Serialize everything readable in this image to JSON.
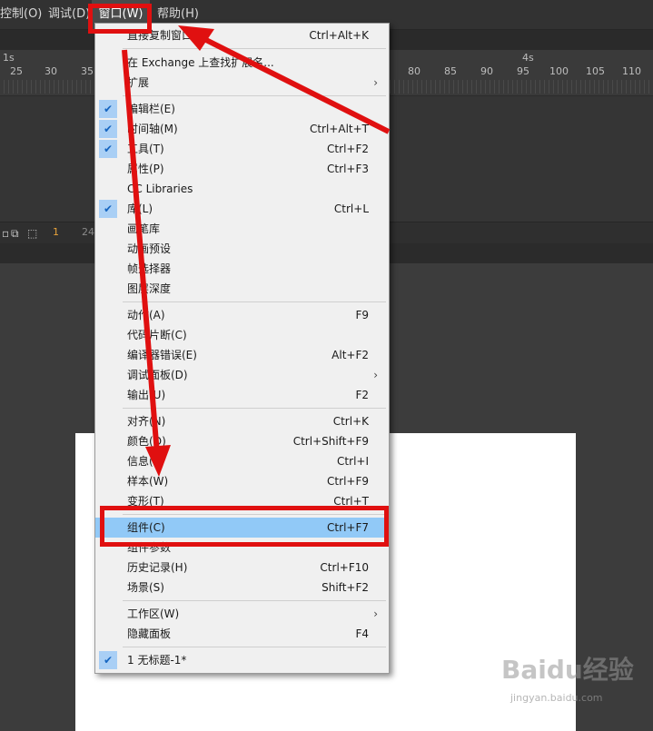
{
  "menubar": {
    "items": [
      {
        "label": "控制(O)"
      },
      {
        "label": "调试(D)"
      },
      {
        "label": "窗口(W)"
      },
      {
        "label": "帮助(H)"
      }
    ]
  },
  "ruler": {
    "seconds": [
      "1s",
      "4s"
    ],
    "frames": [
      "25",
      "30",
      "35",
      "80",
      "85",
      "90",
      "95",
      "100",
      "105",
      "110"
    ]
  },
  "timeline_toolbar": {
    "frame_a": "1",
    "frame_b": "24"
  },
  "menu": {
    "items": [
      {
        "label": "直接复制窗口(D)",
        "shortcut": "Ctrl+Alt+K"
      },
      {
        "label": "在 Exchange 上查找扩展名...",
        "shortcut": ""
      },
      {
        "label": "扩展",
        "shortcut": "",
        "submenu": true
      },
      {
        "label": "编辑栏(E)",
        "shortcut": "",
        "checked": true
      },
      {
        "label": "时间轴(M)",
        "shortcut": "Ctrl+Alt+T",
        "checked": true
      },
      {
        "label": "工具(T)",
        "shortcut": "Ctrl+F2",
        "checked": true
      },
      {
        "label": "属性(P)",
        "shortcut": "Ctrl+F3"
      },
      {
        "label": "CC Libraries",
        "shortcut": ""
      },
      {
        "label": "库(L)",
        "shortcut": "Ctrl+L",
        "checked": true
      },
      {
        "label": "画笔库",
        "shortcut": ""
      },
      {
        "label": "动画预设",
        "shortcut": ""
      },
      {
        "label": "帧选择器",
        "shortcut": ""
      },
      {
        "label": "图层深度",
        "shortcut": ""
      },
      {
        "label": "动作(A)",
        "shortcut": "F9"
      },
      {
        "label": "代码片断(C)",
        "shortcut": ""
      },
      {
        "label": "编译器错误(E)",
        "shortcut": "Alt+F2"
      },
      {
        "label": "调试面板(D)",
        "shortcut": "",
        "submenu": true
      },
      {
        "label": "输出(U)",
        "shortcut": "F2"
      },
      {
        "label": "对齐(N)",
        "shortcut": "Ctrl+K"
      },
      {
        "label": "颜色(O)",
        "shortcut": "Ctrl+Shift+F9"
      },
      {
        "label": "信息(I)",
        "shortcut": "Ctrl+I"
      },
      {
        "label": "样本(W)",
        "shortcut": "Ctrl+F9"
      },
      {
        "label": "变形(T)",
        "shortcut": "Ctrl+T"
      },
      {
        "label": "组件(C)",
        "shortcut": "Ctrl+F7",
        "highlighted": true
      },
      {
        "label": "组件参数",
        "shortcut": ""
      },
      {
        "label": "历史记录(H)",
        "shortcut": "Ctrl+F10"
      },
      {
        "label": "场景(S)",
        "shortcut": "Shift+F2"
      },
      {
        "label": "工作区(W)",
        "shortcut": "",
        "submenu": true
      },
      {
        "label": "隐藏面板",
        "shortcut": "F4"
      },
      {
        "label": "1 无标题-1*",
        "shortcut": "",
        "checked": true
      }
    ]
  },
  "watermark": {
    "brand": "Baidu经验",
    "url": "jingyan.baidu.com"
  },
  "colors": {
    "highlight": "#91c9f7",
    "annotation": "#e01010",
    "check": "#1565c0"
  }
}
